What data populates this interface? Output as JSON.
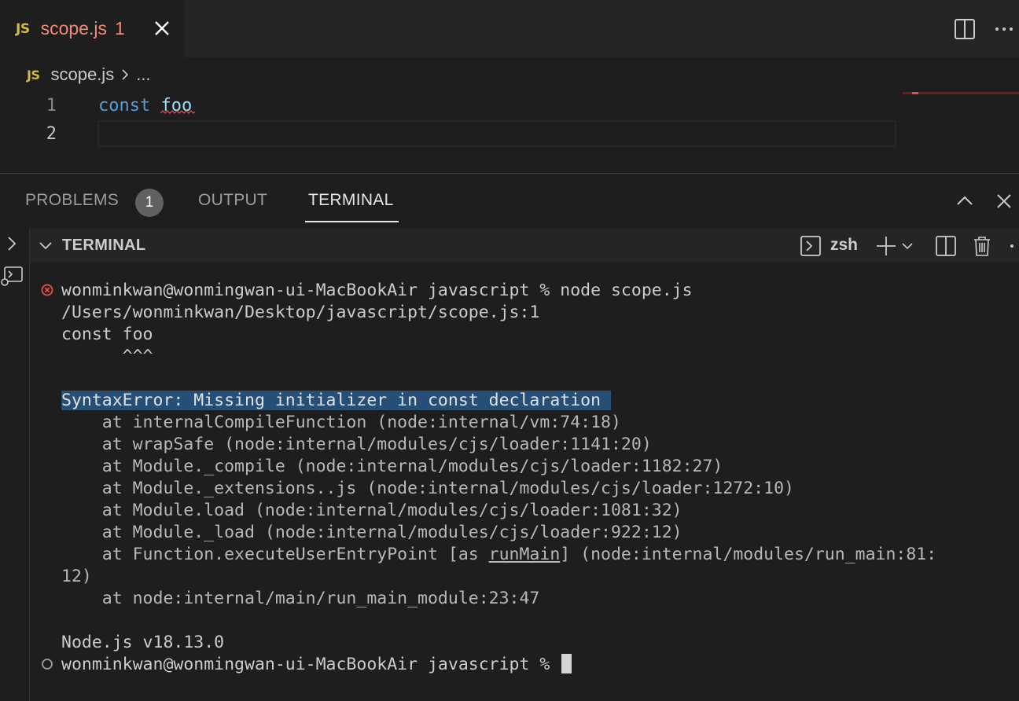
{
  "editor": {
    "tab": {
      "lang_badge": "JS",
      "label": "scope.js",
      "problem_count": "1"
    },
    "breadcrumb": {
      "lang_badge": "JS",
      "file": "scope.js",
      "more": "..."
    },
    "lines": [
      {
        "number": "1",
        "keyword": "const",
        "identifier": "foo"
      },
      {
        "number": "2"
      }
    ]
  },
  "panel": {
    "tabs": {
      "problems": "PROBLEMS",
      "problems_badge": "1",
      "output": "OUTPUT",
      "terminal": "TERMINAL"
    },
    "terminal_title": "TERMINAL",
    "shell": "zsh"
  },
  "terminal": {
    "prompt_line": "wonminkwan@wonmingwan-ui-MacBookAir javascript % node scope.js",
    "file_ref": "/Users/wonminkwan/Desktop/javascript/scope.js:1",
    "source": "const foo",
    "caret": "      ^^^",
    "error": "SyntaxError: Missing initializer in const declaration ",
    "stack": [
      "    at internalCompileFunction (node:internal/vm:74:18)",
      "    at wrapSafe (node:internal/modules/cjs/loader:1141:20)",
      "    at Module._compile (node:internal/modules/cjs/loader:1182:27)",
      "    at Module._extensions..js (node:internal/modules/cjs/loader:1272:10)",
      "    at Module.load (node:internal/modules/cjs/loader:1081:32)",
      "    at Module._load (node:internal/modules/cjs/loader:922:12)"
    ],
    "stack_entry_pre": "    at Function.executeUserEntryPoint [as ",
    "stack_entry_link": "runMain",
    "stack_entry_post": "] (node:internal/modules/run_main:81:",
    "stack_entry_wrap": "12)",
    "stack_last": "    at node:internal/main/run_main_module:23:47",
    "node_version": "Node.js v18.13.0",
    "final_prompt": "wonminkwan@wonmingwan-ui-MacBookAir javascript % "
  },
  "colors": {
    "error_red": "#f14c4c",
    "accent": "#e7e7e7",
    "selection": "#264f78"
  }
}
